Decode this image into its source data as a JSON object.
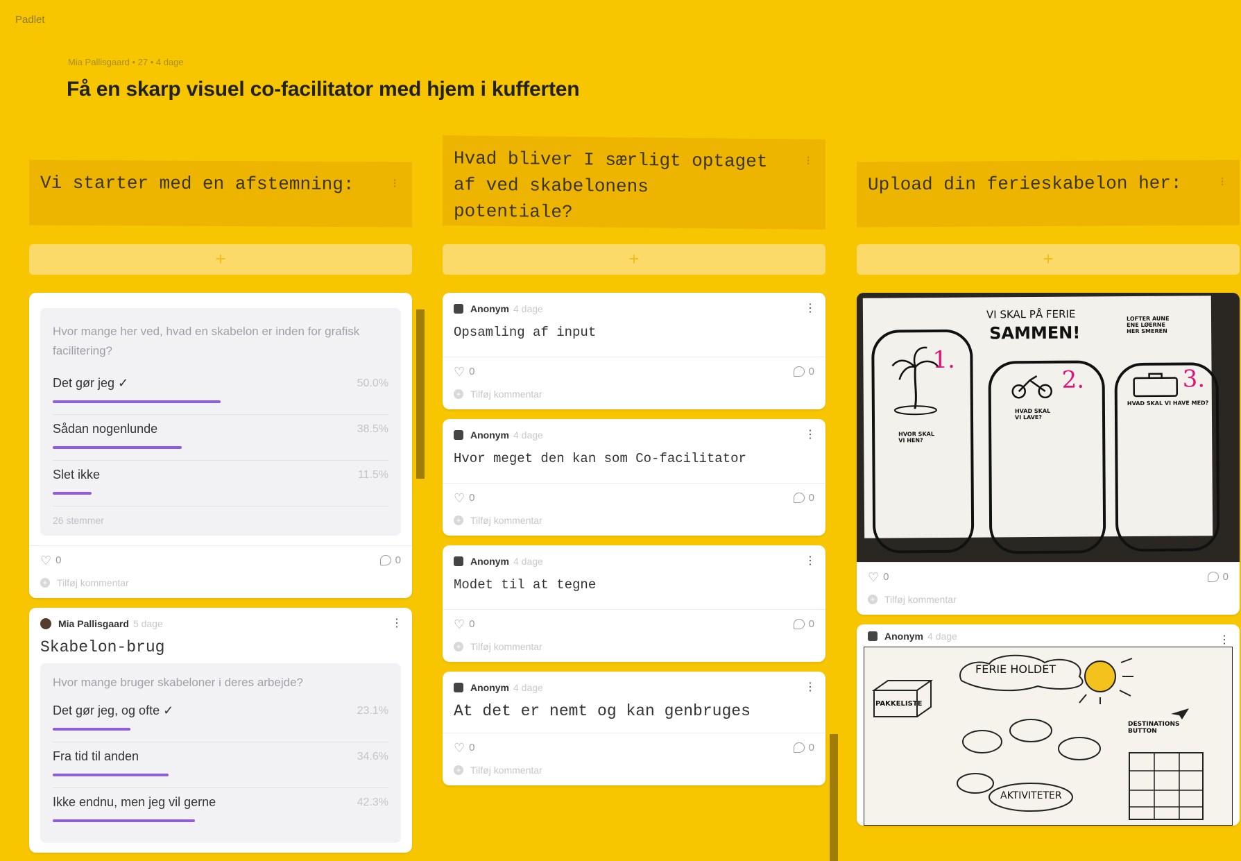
{
  "app": {
    "name": "Padlet"
  },
  "board": {
    "meta": "Mia Pallisgaard • 27 • 4 dage",
    "title": "Få en skarp visuel co-facilitator med hjem i kufferten"
  },
  "columns": [
    {
      "title": "Vi starter med en afstemning:",
      "cards": [
        {
          "poll": {
            "question": "Hvor mange her ved, hvad en skabelon er inden for grafisk facilitering?",
            "options": [
              {
                "label": "Det gør jeg ✓",
                "pct": "50.0%",
                "value": 50.0
              },
              {
                "label": "Sådan nogenlunde",
                "pct": "38.5%",
                "value": 38.5
              },
              {
                "label": "Slet ikke",
                "pct": "11.5%",
                "value": 11.5
              }
            ],
            "votes": "26 stemmer"
          },
          "likes": "0",
          "comments": "0",
          "add_comment": "Tilføj kommentar"
        },
        {
          "author": "Mia Pallisgaard",
          "age": "5 dage",
          "subject": "Skabelon-brug",
          "poll": {
            "question": "Hvor mange bruger skabeloner i deres arbejde?",
            "options": [
              {
                "label": "Det gør jeg, og ofte ✓",
                "pct": "23.1%",
                "value": 23.1
              },
              {
                "label": "Fra tid til anden",
                "pct": "34.6%",
                "value": 34.6
              },
              {
                "label": "Ikke endnu, men jeg vil gerne",
                "pct": "42.3%",
                "value": 42.3
              }
            ]
          }
        }
      ]
    },
    {
      "title": "Hvad bliver I særligt optaget af ved skabelonens potentiale?",
      "cards": [
        {
          "author": "Anonym",
          "age": "4 dage",
          "text": "Opsamling af input",
          "likes": "0",
          "comments": "0",
          "add_comment": "Tilføj kommentar"
        },
        {
          "author": "Anonym",
          "age": "4 dage",
          "text": "Hvor meget den kan som Co-facilitator",
          "likes": "0",
          "comments": "0",
          "add_comment": "Tilføj kommentar"
        },
        {
          "author": "Anonym",
          "age": "4 dage",
          "text": "Modet til at tegne",
          "likes": "0",
          "comments": "0",
          "add_comment": "Tilføj kommentar"
        },
        {
          "author": "Anonym",
          "age": "4 dage",
          "text": "At det er nemt og kan genbruges",
          "likes": "0",
          "comments": "0",
          "add_comment": "Tilføj kommentar"
        }
      ]
    },
    {
      "title": "Upload din ferieskabelon her:",
      "cards": [
        {
          "sketch": {
            "heading": "VI SKAL PÅ FERIE",
            "heading2": "SAMMEN!",
            "note": "LOFTER AUNE ENE LØERNE HER SMEREN",
            "q1": "HVOR SKAL VI HEN?",
            "q2": "HVAD SKAL VI LAVE?",
            "q3": "HVAD SKAL VI HAVE MED?",
            "n1": "1.",
            "n2": "2.",
            "n3": "3."
          },
          "likes": "0",
          "comments": "0",
          "add_comment": "Tilføj kommentar"
        },
        {
          "author": "Anonym",
          "age": "4 dage",
          "sketch": {
            "title": "FERIE HOLDET",
            "box": "PAKKELISTE",
            "bubbles": "AKTIVITETER",
            "dest": "DESTINATIONS BUTTON"
          }
        }
      ]
    }
  ],
  "ui": {
    "add_post": "+",
    "menu": "⋮",
    "col_menu": "⁝"
  },
  "colors": {
    "background": "#f7c600",
    "header": "#edb400",
    "poll_bar": "#8f5ce8"
  }
}
